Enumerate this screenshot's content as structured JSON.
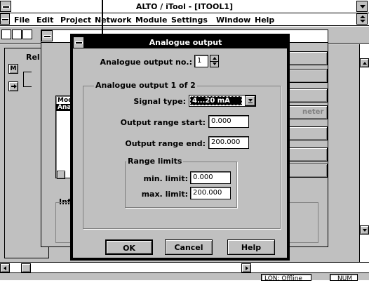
{
  "main_window": {
    "title": "ALTO / iTool - [ITOOL1]",
    "menu": [
      "File",
      "Edit",
      "Project",
      "Network",
      "Module",
      "Settings",
      "Window",
      "Help"
    ]
  },
  "background": {
    "rel_label": "Rel",
    "m_button": "M",
    "list_items": [
      "Mod",
      "Ana"
    ],
    "info_label": "Info",
    "meter_label": "neter"
  },
  "status_bar": {
    "lon_status": "LON: Offline",
    "num_status": "NUM"
  },
  "dialog": {
    "title": "Analogue output",
    "output_no_label": "Analogue output no.:",
    "output_no_value": "1",
    "group_title": "Analogue output 1 of 2",
    "signal_type_label": "Signal type:",
    "signal_type_value": "4...20 mA",
    "range_start_label": "Output range start:",
    "range_start_value": "0.000",
    "range_end_label": "Output range end:",
    "range_end_value": "200.000",
    "limits_title": "Range limits",
    "min_label": "min. limit:",
    "min_value": "0.000",
    "max_label": "max. limit:",
    "max_value": "200.000",
    "ok": "OK",
    "cancel": "Cancel",
    "help": "Help"
  }
}
